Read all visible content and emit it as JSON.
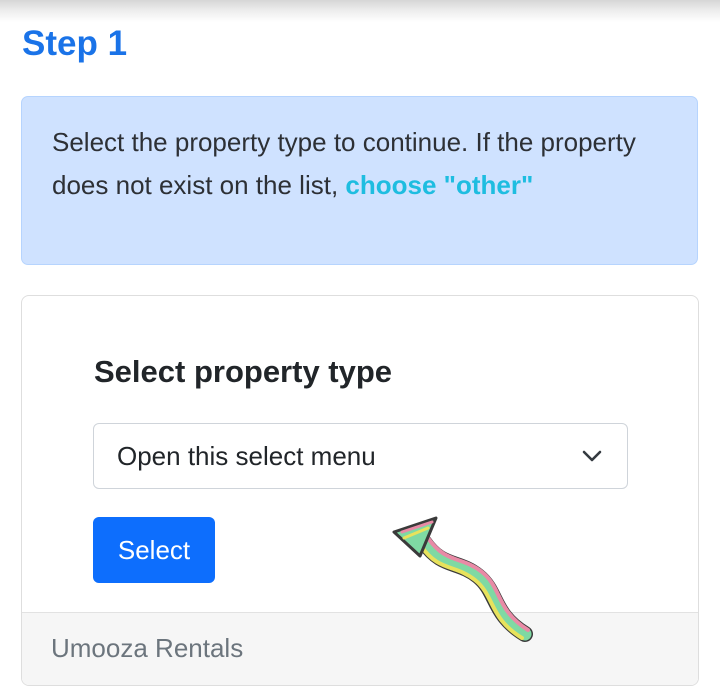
{
  "step": {
    "title": "Step 1"
  },
  "info": {
    "text": "Select the property type to continue. If the property does not exist on the list, ",
    "link_text": "choose \"other\""
  },
  "form": {
    "title": "Select property type",
    "select_value": "Open this select menu",
    "button_label": "Select"
  },
  "footer": {
    "text": "Umooza Rentals"
  },
  "icons": {
    "dropdown": "chevron-down-icon",
    "annotation": "arrow-annotation"
  },
  "colors": {
    "accent": "#1a73e8",
    "link": "#1ebde0",
    "info_bg": "#cfe2ff",
    "button": "#0d6efd"
  }
}
